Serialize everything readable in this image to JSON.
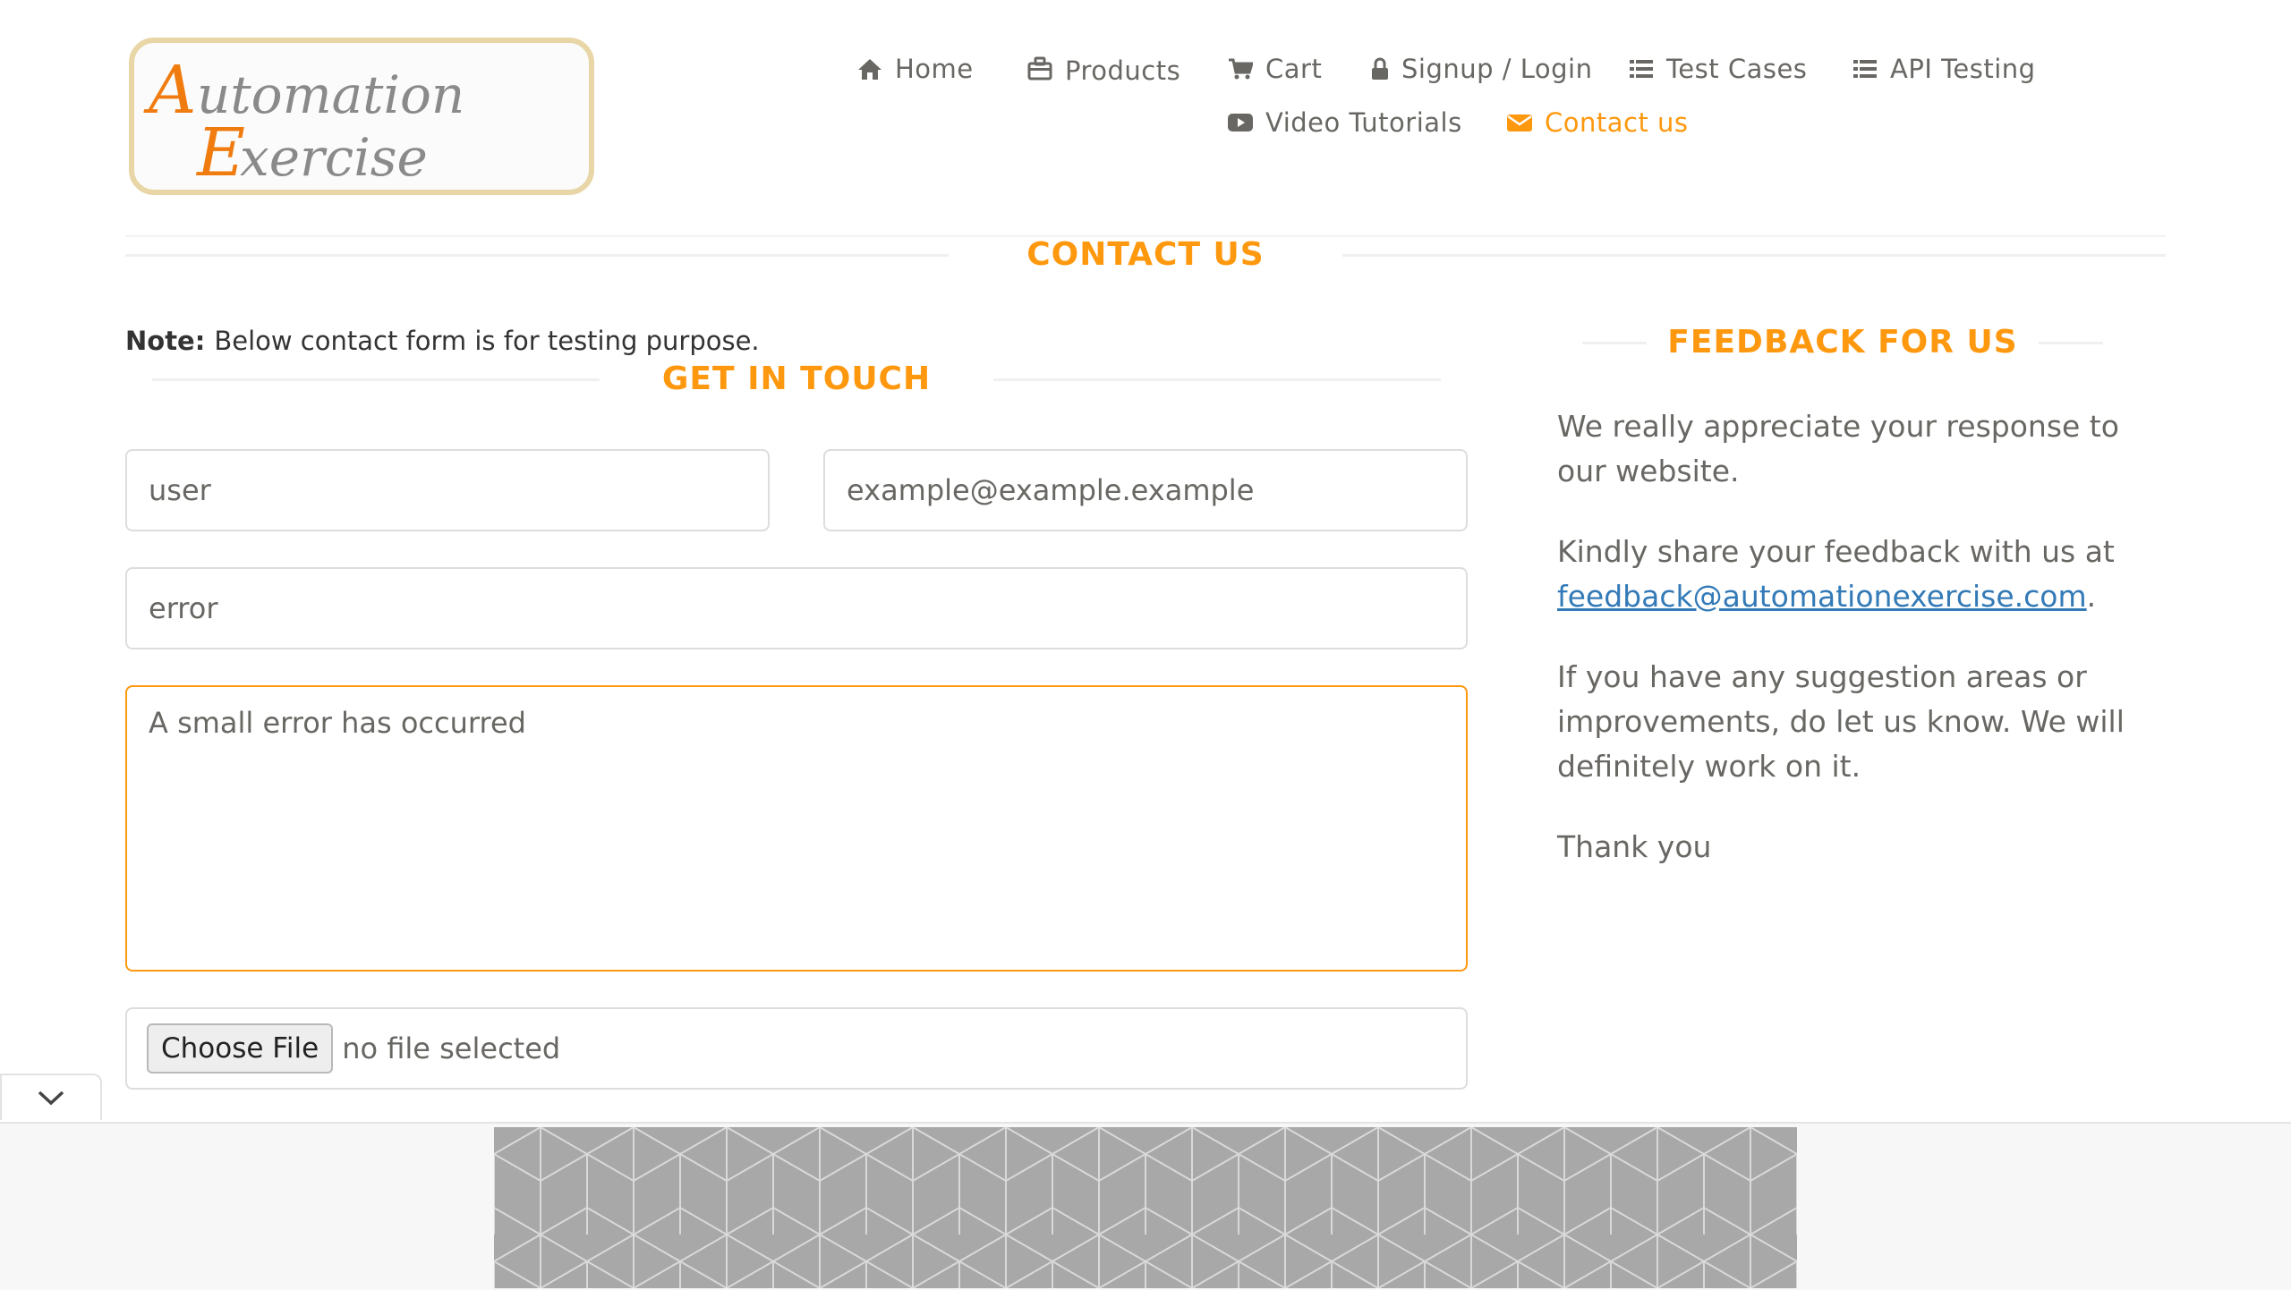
{
  "logo": {
    "line1": "Automation",
    "line2": "Exercise"
  },
  "nav": [
    {
      "label": "Home",
      "icon": "home-icon"
    },
    {
      "label": "Products",
      "icon": "briefcase-icon"
    },
    {
      "label": "Cart",
      "icon": "cart-icon"
    },
    {
      "label": "Signup / Login",
      "icon": "lock-icon"
    },
    {
      "label": "Test Cases",
      "icon": "list-icon"
    },
    {
      "label": "API Testing",
      "icon": "list-icon"
    },
    {
      "label": "Video Tutorials",
      "icon": "youtube-play-icon"
    },
    {
      "label": "Contact us",
      "icon": "envelope-icon",
      "active": true
    }
  ],
  "page_title": "Contact Us",
  "note": {
    "label": "Note:",
    "text": "Below contact form is for testing purpose."
  },
  "form": {
    "title": "Get In Touch",
    "name_value": "user",
    "email_value": "example@example.example",
    "subject_value": "error",
    "message_value": "A small error has occurred",
    "file_button": "Choose File",
    "file_status": "no file selected"
  },
  "feedback": {
    "title": "Feedback For Us",
    "p1": "We really appreciate your response to our website.",
    "p2_text": "Kindly share your feedback with us at",
    "p2_link": "feedback@automationexercise.com",
    "p2_end": ".",
    "p3": "If you have any suggestion areas or improvements, do let us know. We will definitely work on it.",
    "p4": "Thank you"
  },
  "colors": {
    "accent": "#FE980F",
    "text": "#696763",
    "link": "#337ab7",
    "border": "#dddddd"
  }
}
